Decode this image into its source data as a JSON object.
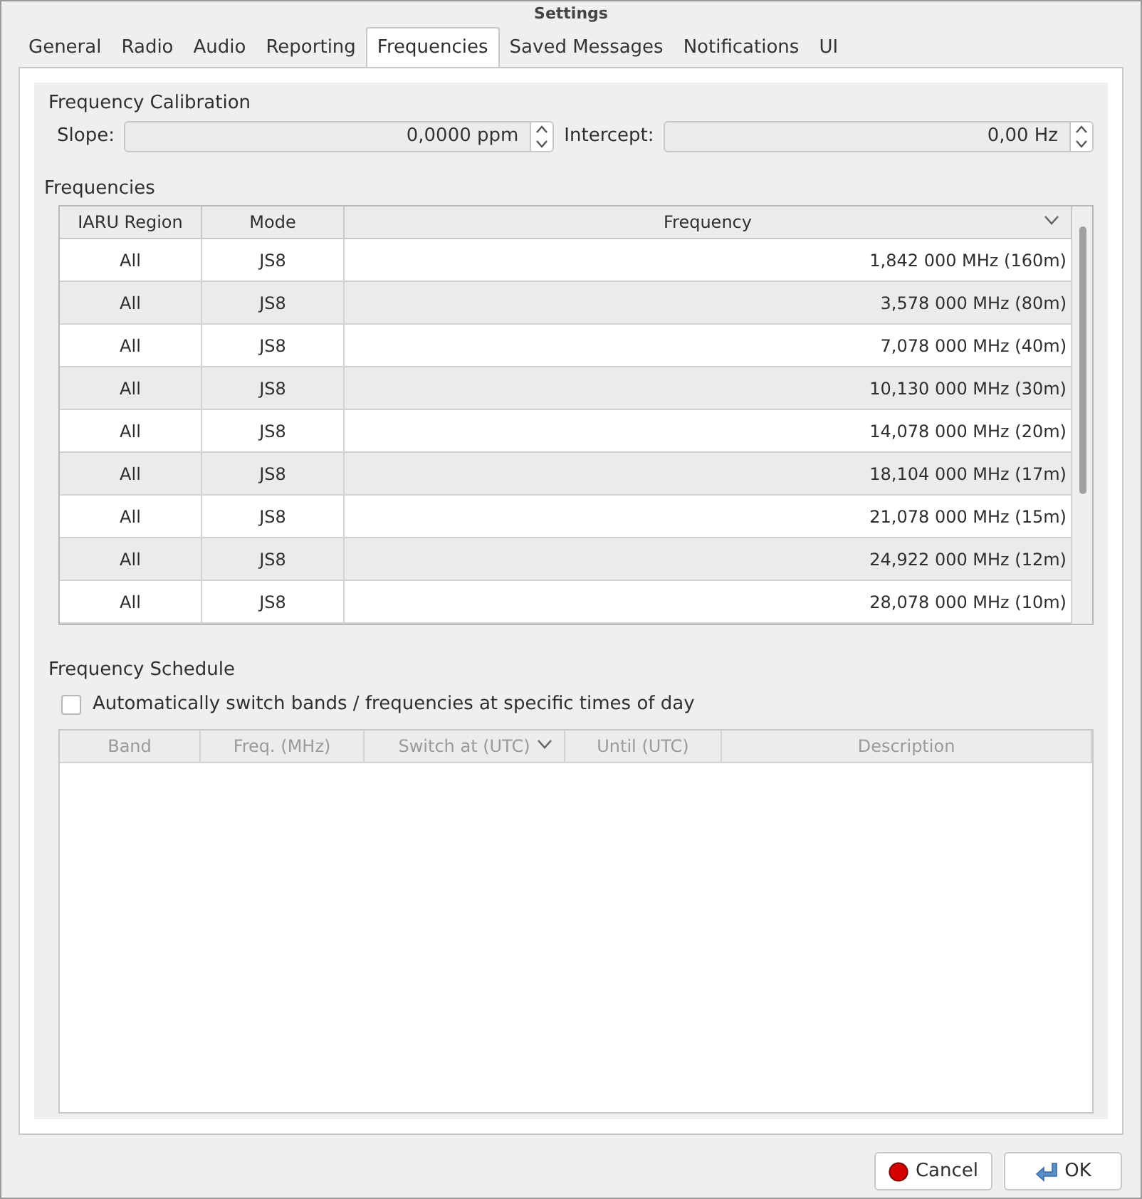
{
  "window": {
    "title": "Settings"
  },
  "tabs": [
    {
      "label": "General",
      "selected": false
    },
    {
      "label": "Radio",
      "selected": false
    },
    {
      "label": "Audio",
      "selected": false
    },
    {
      "label": "Reporting",
      "selected": false
    },
    {
      "label": "Frequencies",
      "selected": true
    },
    {
      "label": "Saved Messages",
      "selected": false
    },
    {
      "label": "Notifications",
      "selected": false
    },
    {
      "label": "UI",
      "selected": false
    }
  ],
  "calibration": {
    "title": "Frequency Calibration",
    "slope_label": "Slope:",
    "slope_value": "0,0000 ppm",
    "intercept_label": "Intercept:",
    "intercept_value": "0,00 Hz"
  },
  "frequencies": {
    "title": "Frequencies",
    "columns": [
      "IARU Region",
      "Mode",
      "Frequency"
    ],
    "rows": [
      [
        "All",
        "JS8",
        "1,842 000 MHz (160m)"
      ],
      [
        "All",
        "JS8",
        "3,578 000 MHz (80m)"
      ],
      [
        "All",
        "JS8",
        "7,078 000 MHz (40m)"
      ],
      [
        "All",
        "JS8",
        "10,130 000 MHz (30m)"
      ],
      [
        "All",
        "JS8",
        "14,078 000 MHz (20m)"
      ],
      [
        "All",
        "JS8",
        "18,104 000 MHz (17m)"
      ],
      [
        "All",
        "JS8",
        "21,078 000 MHz (15m)"
      ],
      [
        "All",
        "JS8",
        "24,922 000 MHz (12m)"
      ],
      [
        "All",
        "JS8",
        "28,078 000 MHz (10m)"
      ]
    ]
  },
  "schedule": {
    "title": "Frequency Schedule",
    "auto_switch": {
      "label": "Automatically switch bands / frequencies at specific times of day",
      "checked": false
    },
    "disabled": true,
    "columns": [
      "Band",
      "Freq. (MHz)",
      "Switch at (UTC)",
      "Until (UTC)",
      "Description"
    ]
  },
  "buttons": [
    {
      "kind": "cancel",
      "label": "Cancel"
    },
    {
      "kind": "ok",
      "label": "OK"
    }
  ]
}
